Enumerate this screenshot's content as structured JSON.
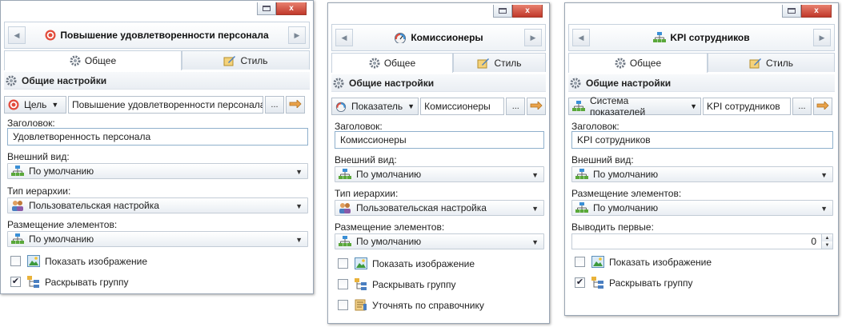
{
  "window_controls": {
    "restore_symbol": "",
    "close_symbol": "x"
  },
  "nav": {
    "prev_symbol": "◀",
    "next_symbol": "▶"
  },
  "panels": [
    {
      "title": "Повышение удовлетворенности персонала",
      "title_icon": "target-icon",
      "tabs": [
        "Общее",
        "Стиль"
      ],
      "section": "Общие настройки",
      "source_button": "Цель",
      "source_value": "Повышение удовлетворенности персонала",
      "browse_label": "...",
      "heading_label": "Заголовок:",
      "heading_value": "Удовлетворенность персонала",
      "fields": [
        {
          "label": "Внешний вид:",
          "value": "По умолчанию",
          "icon": "hierarchy-icon"
        },
        {
          "label": "Тип иерархии:",
          "value": "Пользовательская настройка",
          "icon": "users-icon"
        },
        {
          "label": "Размещение элементов:",
          "value": "По умолчанию",
          "icon": "hierarchy-icon"
        }
      ],
      "checkboxes": [
        {
          "label": "Показать изображение",
          "checked": false,
          "mark": ""
        },
        {
          "label": "Раскрывать группу",
          "checked": true,
          "mark": "✔"
        }
      ]
    },
    {
      "title": "Комиссионеры",
      "title_icon": "gauge-icon",
      "tabs": [
        "Общее",
        "Стиль"
      ],
      "section": "Общие настройки",
      "source_button": "Показатель",
      "source_value": "Комиссионеры",
      "browse_label": "...",
      "heading_label": "Заголовок:",
      "heading_value": "Комиссионеры",
      "fields": [
        {
          "label": "Внешний вид:",
          "value": "По умолчанию",
          "icon": "hierarchy-icon"
        },
        {
          "label": "Тип иерархии:",
          "value": "Пользовательская настройка",
          "icon": "users-icon"
        },
        {
          "label": "Размещение элементов:",
          "value": "По умолчанию",
          "icon": "hierarchy-icon"
        }
      ],
      "checkboxes": [
        {
          "label": "Показать изображение",
          "checked": false,
          "mark": ""
        },
        {
          "label": "Раскрывать группу",
          "checked": false,
          "mark": ""
        },
        {
          "label": "Уточнять по справочнику",
          "checked": false,
          "mark": ""
        }
      ]
    },
    {
      "title": "KPI сотрудников",
      "title_icon": "hierarchy-icon",
      "tabs": [
        "Общее",
        "Стиль"
      ],
      "section": "Общие настройки",
      "source_button": "Система показателей",
      "source_value": "KPI сотрудников",
      "browse_label": "...",
      "heading_label": "Заголовок:",
      "heading_value": "KPI сотрудников",
      "fields": [
        {
          "label": "Внешний вид:",
          "value": "По умолчанию",
          "icon": "hierarchy-icon"
        },
        {
          "label": "Размещение элементов:",
          "value": "По умолчанию",
          "icon": "hierarchy-icon"
        }
      ],
      "spin": {
        "label": "Выводить первые:",
        "value": "0"
      },
      "checkboxes": [
        {
          "label": "Показать изображение",
          "checked": false,
          "mark": ""
        },
        {
          "label": "Раскрывать группу",
          "checked": true,
          "mark": "✔"
        }
      ]
    }
  ],
  "colors": {
    "accent_border": "#8fb0cc",
    "panel_border": "#9aa6b4",
    "close_red": "#c0392b"
  }
}
